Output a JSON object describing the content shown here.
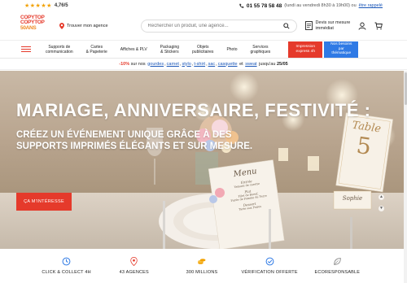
{
  "topbar": {
    "rating": "4,76/5",
    "phone": "01 55 78 58 48",
    "hours": "(lundi au vendredi 8h30 à 19h00) ou",
    "callback": "être rappelé"
  },
  "header": {
    "logo_line1": "COPYTOP",
    "logo_line2": "COPYTOP",
    "logo_line3": "50ANS",
    "agency_label": "Trouver mon agence",
    "search_placeholder": "Rechercher un produit, une agence...",
    "devis_line1": "Devis sur mesure",
    "devis_line2": "immédiat"
  },
  "nav": {
    "items": [
      {
        "line1": "Supports de",
        "line2": "communication"
      },
      {
        "line1": "Cartes",
        "line2": "& Papeterie"
      },
      {
        "line1": "Affiches & PLV",
        "line2": ""
      },
      {
        "line1": "Packaging",
        "line2": "& Stickers"
      },
      {
        "line1": "Objets",
        "line2": "publicitaires"
      },
      {
        "line1": "Photo",
        "line2": ""
      },
      {
        "line1": "Services",
        "line2": "graphiques"
      }
    ],
    "red_btn_line1": "Impression",
    "red_btn_line2": "express 4h",
    "blue_btn_line1": "Nos besoins",
    "blue_btn_line2": "par thématique"
  },
  "promo": {
    "pct": "-10%",
    "pre": "sur nos",
    "links": [
      "gourdes",
      "carnet",
      "stylo",
      "t-shirt",
      "sac",
      "casquette",
      "sweat"
    ],
    "and": "et",
    "post": "jusqu'au",
    "date": "25/05"
  },
  "hero": {
    "title": "MARIAGE, ANNIVERSAIRE, FESTIVITÉ :",
    "subtitle": "CRÉEZ UN ÉVÉNEMENT UNIQUE GRÂCE À DES SUPPORTS IMPRIMÉS ÉLÉGANTS ET SUR MESURE.",
    "cta": "ÇA M'INTÉRESSE",
    "table_label": "Table",
    "table_number": "5",
    "menu_title": "Menu",
    "menu_lines": [
      "Entrée",
      "Velouté de carotte",
      "Plat",
      "Filet de Boeuf,",
      "Purée de Pomme de Terre",
      "Dessert",
      "Tarte aux Poires"
    ],
    "place_card": "Sophie"
  },
  "features": [
    {
      "label": "CLICK & COLLECT 4H",
      "icon": "clock-icon"
    },
    {
      "label": "43 AGENCES",
      "icon": "location-icon"
    },
    {
      "label": "300 MILLIONS",
      "icon": "coins-icon"
    },
    {
      "label": "VÉRIFICATION OFFERTE",
      "icon": "check-badge-icon"
    },
    {
      "label": "ECORESPONSABLE",
      "icon": "leaf-icon"
    }
  ]
}
